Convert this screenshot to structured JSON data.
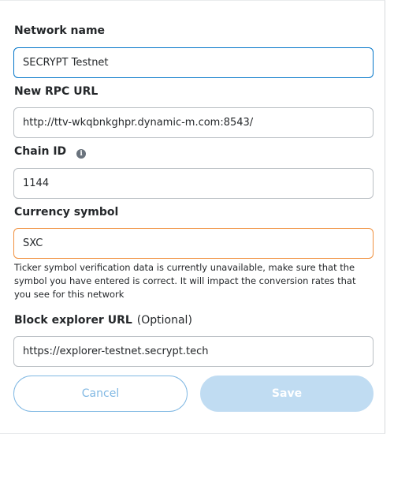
{
  "form": {
    "network_name": {
      "label": "Network name",
      "value": "SECRYPT Testnet"
    },
    "rpc_url": {
      "label": "New RPC URL",
      "value": "http://ttv-wkqbnkghpr.dynamic-m.com:8543/"
    },
    "chain_id": {
      "label": "Chain ID",
      "info_icon": "i",
      "value": "1144"
    },
    "currency_symbol": {
      "label": "Currency symbol",
      "value": "SXC",
      "warning": "Ticker symbol verification data is currently unavailable, make sure that the symbol you have entered is correct. It will impact the conversion rates that you see for this network"
    },
    "block_explorer": {
      "label": "Block explorer URL",
      "optional": "(Optional)",
      "value": "https://explorer-testnet.secrypt.tech"
    }
  },
  "actions": {
    "cancel_label": "Cancel",
    "save_label": "Save"
  },
  "colors": {
    "focus_border": "#0376c9",
    "warning_border": "#f0913f",
    "primary_disabled": "#c0dcf2"
  }
}
